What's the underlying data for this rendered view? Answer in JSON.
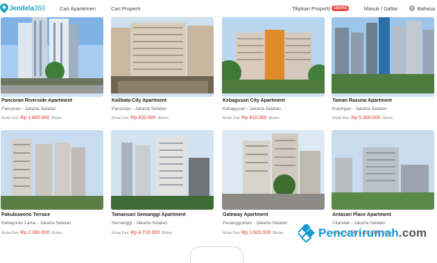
{
  "header": {
    "logo_text": "Jendela",
    "logo_num": "360",
    "nav": [
      "Cari Apartemen",
      "Cari Properti"
    ],
    "titip": "Titipkan Properti",
    "gratis": "GRATIS",
    "masuk": "Masuk / Daftar",
    "bahasa": "Bahasa"
  },
  "listings": [
    {
      "name": "Pancoran Riverside Apartment",
      "location": "Pancoran - Jakarta Selatan",
      "price_prefix": "Mulai Dari",
      "price": "Rp 1.840.000",
      "price_suffix": "/Bulan"
    },
    {
      "name": "Kalibata City Apartment",
      "location": "Pancoran - Jakarta Selatan",
      "price_prefix": "Mulai Dari",
      "price": "Rp 420.000",
      "price_suffix": "/Bulan"
    },
    {
      "name": "Kebagusan City Apartment",
      "location": "Kebagusan - Jakarta Selatan",
      "price_prefix": "Mulai Dari",
      "price": "Rp 810.000",
      "price_suffix": "/Bulan"
    },
    {
      "name": "Taman Rasuna Apartment",
      "location": "Kuningan - Jakarta Selatan",
      "price_prefix": "Mulai Dari",
      "price": "Rp 5.300.000",
      "price_suffix": "/Bulan"
    },
    {
      "name": "Pakubuwono Terrace",
      "location": "Kebayoran Lama - Jakarta Selatan",
      "price_prefix": "Mulai Dari",
      "price": "Rp 2.090.000",
      "price_suffix": "/Bulan"
    },
    {
      "name": "Tamansari Semanggi Apartment",
      "location": "Semanggi - Jakarta Selatan",
      "price_prefix": "Mulai Dari",
      "price": "Rp 4.710.000",
      "price_suffix": "/Bulan"
    },
    {
      "name": "Gateway Apartment",
      "location": "Pesanggrahan - Jakarta Selatan",
      "price_prefix": "Mulai Dari",
      "price": "Rp 1.920.000",
      "price_suffix": "/Bulan"
    },
    {
      "name": "Antasari Place Apartment",
      "location": "Cilandak - Jakarta Selatan",
      "price_prefix": "Mulai Dari",
      "price": "Rp 6.420.000",
      "price_suffix": "/Bulan"
    }
  ],
  "watermark": {
    "main": "Pencarirumah",
    "suffix": ".com"
  },
  "colors": {
    "brand": "#1aa3c8",
    "price": "#d9322c",
    "badge": "#e8433b",
    "watermark": "#1598cf"
  }
}
